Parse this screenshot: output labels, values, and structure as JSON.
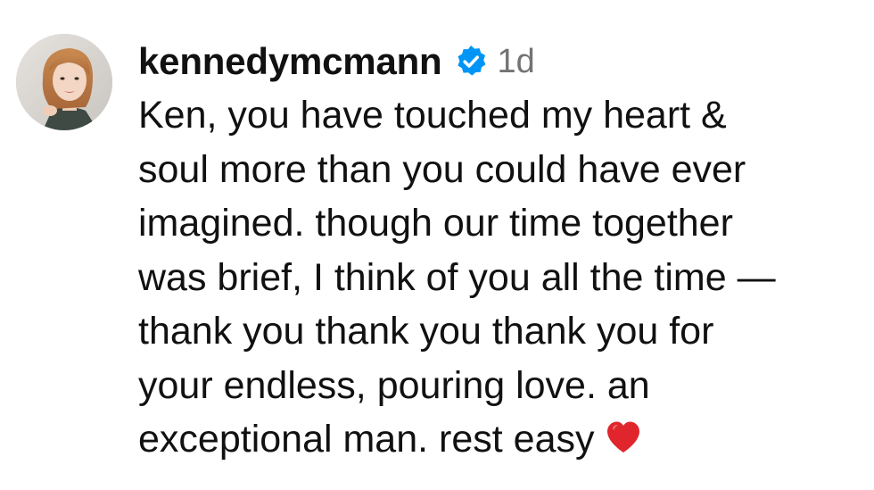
{
  "comment": {
    "username": "kennedymcmann",
    "verified_icon": "verified-badge-icon",
    "timestamp": "1d",
    "text_lines": [
      "Ken, you have touched my heart &",
      "soul more than you could have ever",
      "imagined. though our time together",
      "was brief, I think of you all the time —",
      "thank you thank you thank you for",
      "your endless, pouring love. an",
      "exceptional man. rest easy"
    ],
    "emoji": "red-heart-icon",
    "colors": {
      "verified_blue": "#0095f6",
      "heart_red": "#e0262c",
      "timestamp_gray": "#737373",
      "text": "#111111"
    }
  }
}
